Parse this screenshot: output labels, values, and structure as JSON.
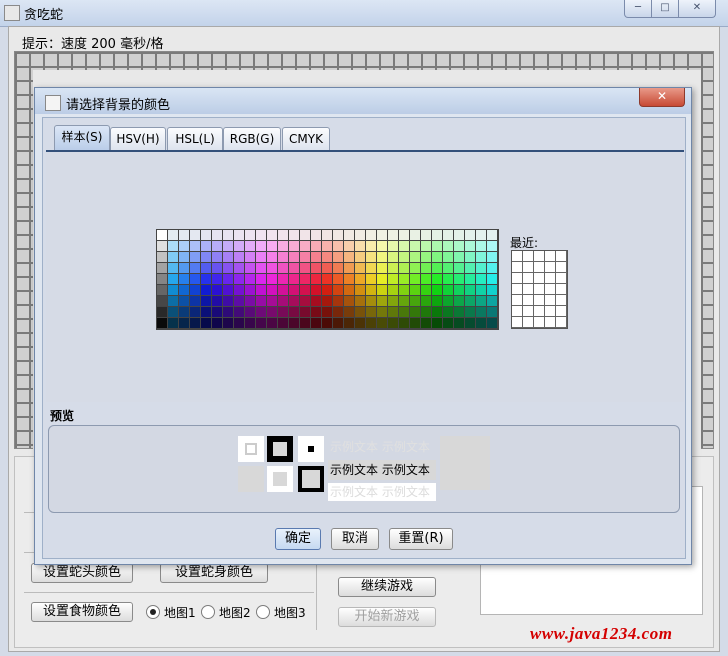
{
  "window": {
    "title": "贪吃蛇",
    "min_label": "─",
    "max_label": "□",
    "close_label": "✕"
  },
  "status": {
    "hint": "提示：速度 200 毫秒/格"
  },
  "controls": {
    "head_color_btn": "设置蛇头颜色",
    "body_color_btn": "设置蛇身颜色",
    "food_color_btn": "设置食物颜色",
    "maps": [
      {
        "label": "地图1",
        "selected": true
      },
      {
        "label": "地图2",
        "selected": false
      },
      {
        "label": "地图3",
        "selected": false
      }
    ],
    "continue_btn": "继续游戏",
    "new_game_btn": "开始新游戏"
  },
  "watermark": "www.java1234.com",
  "dialog": {
    "title": "请选择背景的颜色",
    "close_label": "✕",
    "tabs": [
      {
        "label": "样本(S)",
        "selected": true
      },
      {
        "label": "HSV(H)",
        "selected": false
      },
      {
        "label": "HSL(L)",
        "selected": false
      },
      {
        "label": "RGB(G)",
        "selected": false
      },
      {
        "label": "CMYK",
        "selected": false
      }
    ],
    "recent_label": "最近:",
    "preview_label": "预览",
    "sample_text": "示例文本",
    "ok_btn": "确定",
    "cancel_btn": "取消",
    "reset_btn": "重置(R)"
  },
  "colors": {
    "accent": "#33507a",
    "watermark": "#d40000"
  }
}
